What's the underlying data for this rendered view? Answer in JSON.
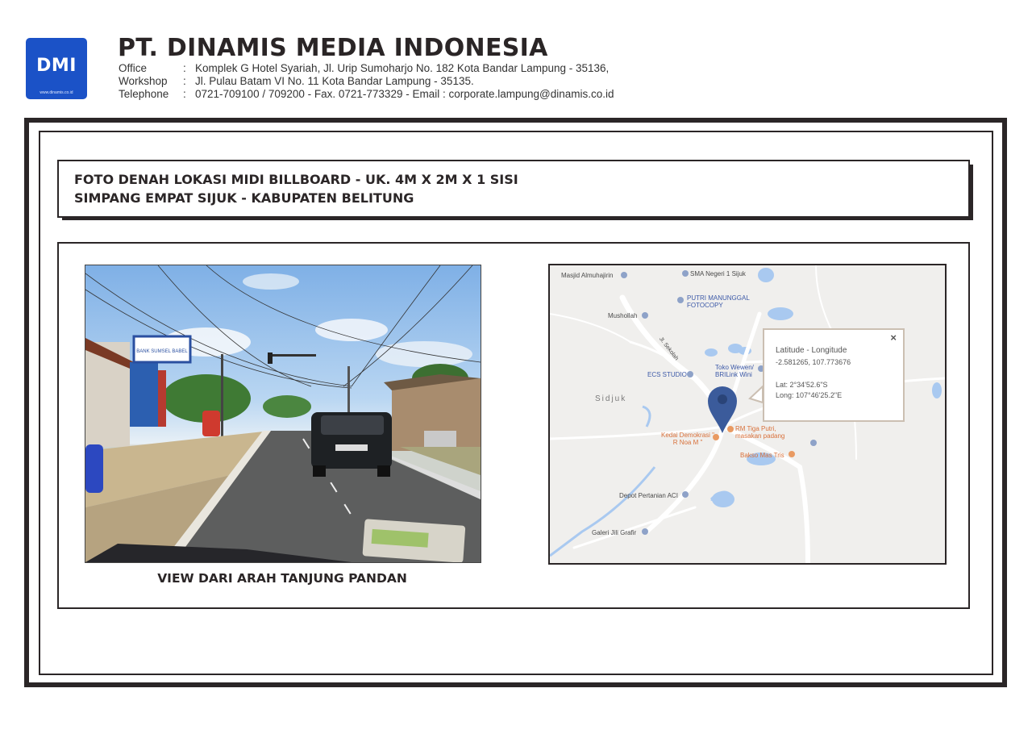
{
  "header": {
    "logo_text": "DMI",
    "logo_web": "www.dinamis.co.id",
    "company_name": "PT. DINAMIS MEDIA INDONESIA",
    "office_label": "Office",
    "office_value": "Komplek G Hotel Syariah, Jl. Urip  Sumoharjo No. 182 Kota Bandar Lampung - 35136,",
    "workshop_label": "Workshop",
    "workshop_value": "Jl. Pulau Batam  VI  No. 11 Kota Bandar Lampung - 35135.",
    "telephone_label": "Telephone",
    "telephone_value": "0721-709100 / 709200 - Fax. 0721-773329 - Email : corporate.lampung@dinamis.co.id",
    "separator": ":"
  },
  "title": {
    "line1": "FOTO DENAH LOKASI MIDI BILLBOARD - UK. 4M X 2M X 1 SISI",
    "line2": "SIMPANG EMPAT SIJUK - KABUPATEN BELITUNG"
  },
  "photo": {
    "caption": "VIEW DARI ARAH TANJUNG PANDAN",
    "sign_text": "BANK SUMSEL BABEL"
  },
  "map": {
    "area_label": "Sidjuk",
    "places": [
      {
        "name": "Masjid Almuhajirin"
      },
      {
        "name": "SMA Negeri 1 Sijuk"
      },
      {
        "name": "PUTRI MANUNGGAL FOTOCOPY"
      },
      {
        "name": "Mushollah"
      },
      {
        "name": "Jl. Sekolah"
      },
      {
        "name": "ECS STUDIO"
      },
      {
        "name": "Toko Wewen/ BRILink Wini"
      },
      {
        "name": "RM Tiga Putri, masakan padang"
      },
      {
        "name": "Kedai Demokrasi \" R Noa M \""
      },
      {
        "name": "Bakso Mas Tris"
      },
      {
        "name": "Depot Pertanian ACI"
      },
      {
        "name": "Galeri Jili Grafir"
      }
    ],
    "popup": {
      "close": "×",
      "heading": "Latitude - Longitude",
      "coords": "-2.581265, 107.773676",
      "lat": "Lat: 2°34'52.6\"S",
      "long": "Long: 107°46'25.2\"E"
    },
    "colors": {
      "pin": "#3b5b9b",
      "road": "#ffffff",
      "water": "#a9c9f0",
      "land": "#f0efed"
    }
  }
}
